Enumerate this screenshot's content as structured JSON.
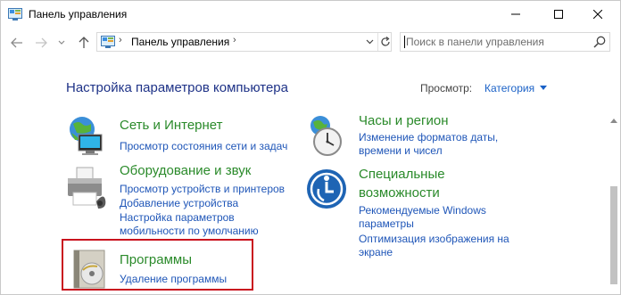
{
  "window": {
    "title": "Панель управления",
    "minimize_icon": "minimize-icon",
    "maximize_icon": "maximize-icon",
    "close_icon": "close-icon"
  },
  "nav": {
    "back_icon": "arrow-left-icon",
    "forward_icon": "arrow-right-icon",
    "recent_icon": "chevron-down-icon",
    "up_icon": "arrow-up-icon"
  },
  "address": {
    "separator": "›",
    "path": "Панель управления",
    "trailing": "›"
  },
  "search": {
    "placeholder": "Поиск в панели управления",
    "value": ""
  },
  "main": {
    "heading": "Настройка параметров компьютера",
    "view_by_label": "Просмотр:",
    "view_by_value": "Категория"
  },
  "categories": [
    {
      "title": "Сеть и Интернет",
      "icon": "network-globe-icon",
      "links": [
        "Просмотр состояния сети и задач"
      ]
    },
    {
      "title": "Оборудование и звук",
      "icon": "printer-icon",
      "links": [
        "Просмотр устройств и принтеров",
        "Добавление устройства",
        "Настройка параметров",
        "мобильности по умолчанию"
      ]
    },
    {
      "title": "Программы",
      "icon": "programs-disc-icon",
      "links": [
        "Удаление программы"
      ]
    },
    {
      "title": "Часы и регион",
      "icon": "clock-globe-icon",
      "links": [
        "Изменение форматов даты,",
        "времени и чисел"
      ]
    },
    {
      "title_lines": [
        "Специальные",
        "возможности"
      ],
      "icon": "ease-of-access-icon",
      "links": [
        "Рекомендуемые Windows",
        "параметры",
        "Оптимизация изображения на",
        "экране"
      ]
    }
  ],
  "colors": {
    "heading": "#1e3287",
    "category_title": "#2a8a2a",
    "link": "#1f56b8",
    "highlight": "#c9121e"
  }
}
